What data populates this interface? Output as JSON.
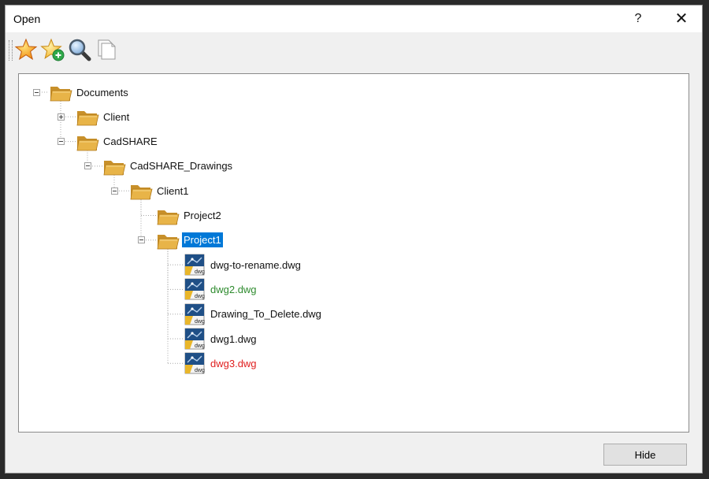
{
  "window": {
    "title": "Open",
    "help_label": "?",
    "close_label": "✕"
  },
  "toolbar": {
    "buttons": [
      {
        "name": "favorites-button",
        "icon": "star-icon"
      },
      {
        "name": "add-favorite-button",
        "icon": "star-add-icon"
      },
      {
        "name": "search-button",
        "icon": "magnifier-icon"
      },
      {
        "name": "copy-button",
        "icon": "copy-pages-icon"
      }
    ]
  },
  "tree": {
    "nodes": [
      {
        "label": "Documents",
        "type": "folder",
        "level": 0,
        "expander": "minus"
      },
      {
        "label": "Client",
        "type": "folder",
        "level": 1,
        "expander": "plus"
      },
      {
        "label": "CadSHARE",
        "type": "folder",
        "level": 1,
        "expander": "minus"
      },
      {
        "label": "CadSHARE_Drawings",
        "type": "folder",
        "level": 2,
        "expander": "minus"
      },
      {
        "label": "Client1",
        "type": "folder",
        "level": 3,
        "expander": "minus"
      },
      {
        "label": "Project2",
        "type": "folder",
        "level": 4,
        "expander": "none"
      },
      {
        "label": "Project1",
        "type": "folder",
        "level": 4,
        "expander": "minus",
        "selected": true
      },
      {
        "label": "dwg-to-rename.dwg",
        "type": "file",
        "level": 5,
        "status": "normal"
      },
      {
        "label": "dwg2.dwg",
        "type": "file",
        "level": 5,
        "status": "green"
      },
      {
        "label": "Drawing_To_Delete.dwg",
        "type": "file",
        "level": 5,
        "status": "normal"
      },
      {
        "label": "dwg1.dwg",
        "type": "file",
        "level": 5,
        "status": "normal"
      },
      {
        "label": "dwg3.dwg",
        "type": "file",
        "level": 5,
        "status": "red"
      }
    ],
    "file_icon_text": "dwg"
  },
  "colors": {
    "selection": "#0078d7",
    "status_green": "#2e8b2e",
    "status_red": "#e02020",
    "folder": "#e8b448"
  },
  "footer": {
    "hide_label": "Hide"
  }
}
